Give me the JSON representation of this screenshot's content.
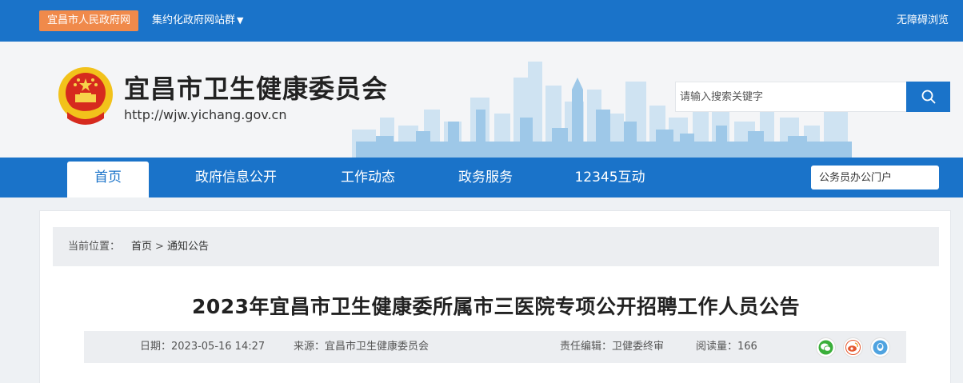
{
  "topbar": {
    "gov_link": "宜昌市人民政府网",
    "site_group": "集约化政府网站群",
    "site_group_caret": "▼",
    "accessible": "无障碍浏览"
  },
  "header": {
    "title": "宜昌市卫生健康委员会",
    "url": "http://wjw.yichang.gov.cn",
    "search_placeholder": "请输入搜索关键字"
  },
  "nav": {
    "items": [
      "首页",
      "政府信息公开",
      "工作动态",
      "政务服务",
      "12345互动"
    ],
    "active_index": 0,
    "portal_placeholder": "公务员办公门户"
  },
  "breadcrumb": {
    "label": "当前位置：",
    "home": "首页",
    "separator": ">",
    "current": "通知公告"
  },
  "article": {
    "title": "2023年宜昌市卫生健康委所属市三医院专项公开招聘工作人员公告",
    "date": "日期：2023-05-16 14:27",
    "source": "来源：宜昌市卫生健康委员会",
    "editor": "责任编辑：卫健委终审",
    "views": "阅读量：166"
  },
  "share": {
    "icons": [
      "wechat-icon",
      "weibo-icon",
      "qq-icon"
    ]
  },
  "colors": {
    "primary": "#1a73c9",
    "orange": "#f08a4b",
    "background": "#eef1f4"
  }
}
